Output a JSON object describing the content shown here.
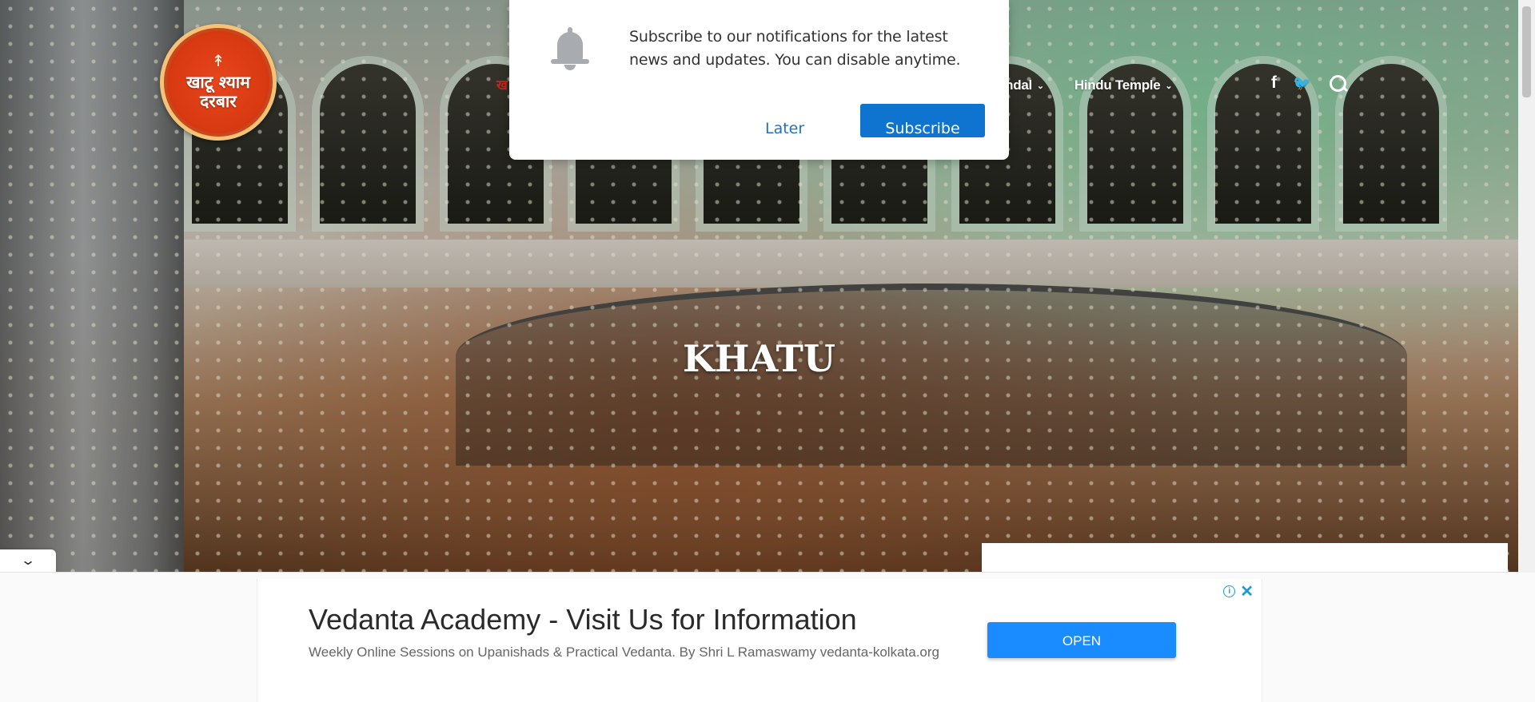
{
  "site": {
    "logo_line1": "खाटू श्याम",
    "logo_line2": "दरबार",
    "logo_bow": "↟"
  },
  "nav": {
    "partial_left": "ख",
    "items": [
      {
        "label": "andal",
        "chevron": "⌄"
      },
      {
        "label": "Hindu Temple",
        "chevron": "⌄"
      }
    ],
    "social": {
      "facebook": "f",
      "twitter": "🐦"
    }
  },
  "hero": {
    "title": "KHATU"
  },
  "notification": {
    "message": "Subscribe to our notifications for the latest news and updates. You can disable anytime.",
    "later_label": "Later",
    "subscribe_label": "Subscribe"
  },
  "ad_toggle": {
    "icon": "⌄"
  },
  "ad": {
    "info_icon": "i",
    "close_icon": "✕",
    "headline": "Vedanta Academy - Visit Us for Information",
    "description": "Weekly Online Sessions on Upanishads & Practical Vedanta. By Shri L Ramaswamy vedanta-kolkata.org",
    "button_label": "OPEN"
  },
  "colors": {
    "primary_blue": "#0f73d0",
    "ad_button_blue": "#1a8cff",
    "logo_red": "#d93a12",
    "nav_accent_red": "#c4261b"
  }
}
